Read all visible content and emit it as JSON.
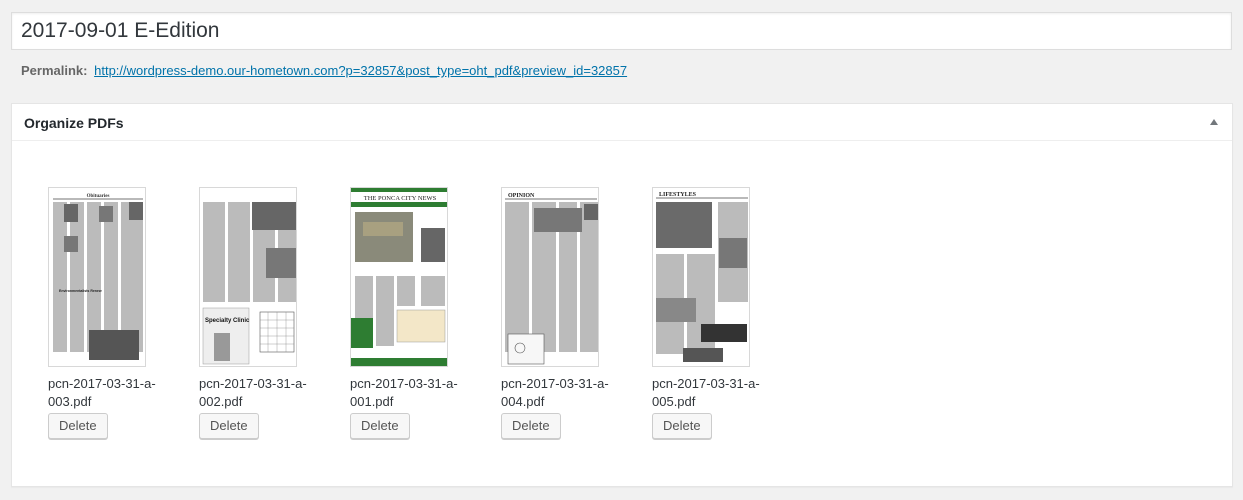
{
  "post": {
    "title": "2017-09-01 E-Edition"
  },
  "permalink": {
    "label": "Permalink:",
    "url": "http://wordpress-demo.our-hometown.com?p=32857&post_type=oht_pdf&preview_id=32857"
  },
  "organize_box": {
    "title": "Organize PDFs",
    "toggle_icon": "triangle-up-icon",
    "delete_label": "Delete",
    "pdfs": [
      {
        "filename": "pcn-2017-03-31-a-003.pdf",
        "thumb_heading": "Obituaries"
      },
      {
        "filename": "pcn-2017-03-31-a-002.pdf",
        "thumb_heading": "Specialty Clinic"
      },
      {
        "filename": "pcn-2017-03-31-a-001.pdf",
        "thumb_heading": "THE PONCA CITY NEWS"
      },
      {
        "filename": "pcn-2017-03-31-a-004.pdf",
        "thumb_heading": "OPINION"
      },
      {
        "filename": "pcn-2017-03-31-a-005.pdf",
        "thumb_heading": "LIFESTYLES"
      }
    ]
  }
}
